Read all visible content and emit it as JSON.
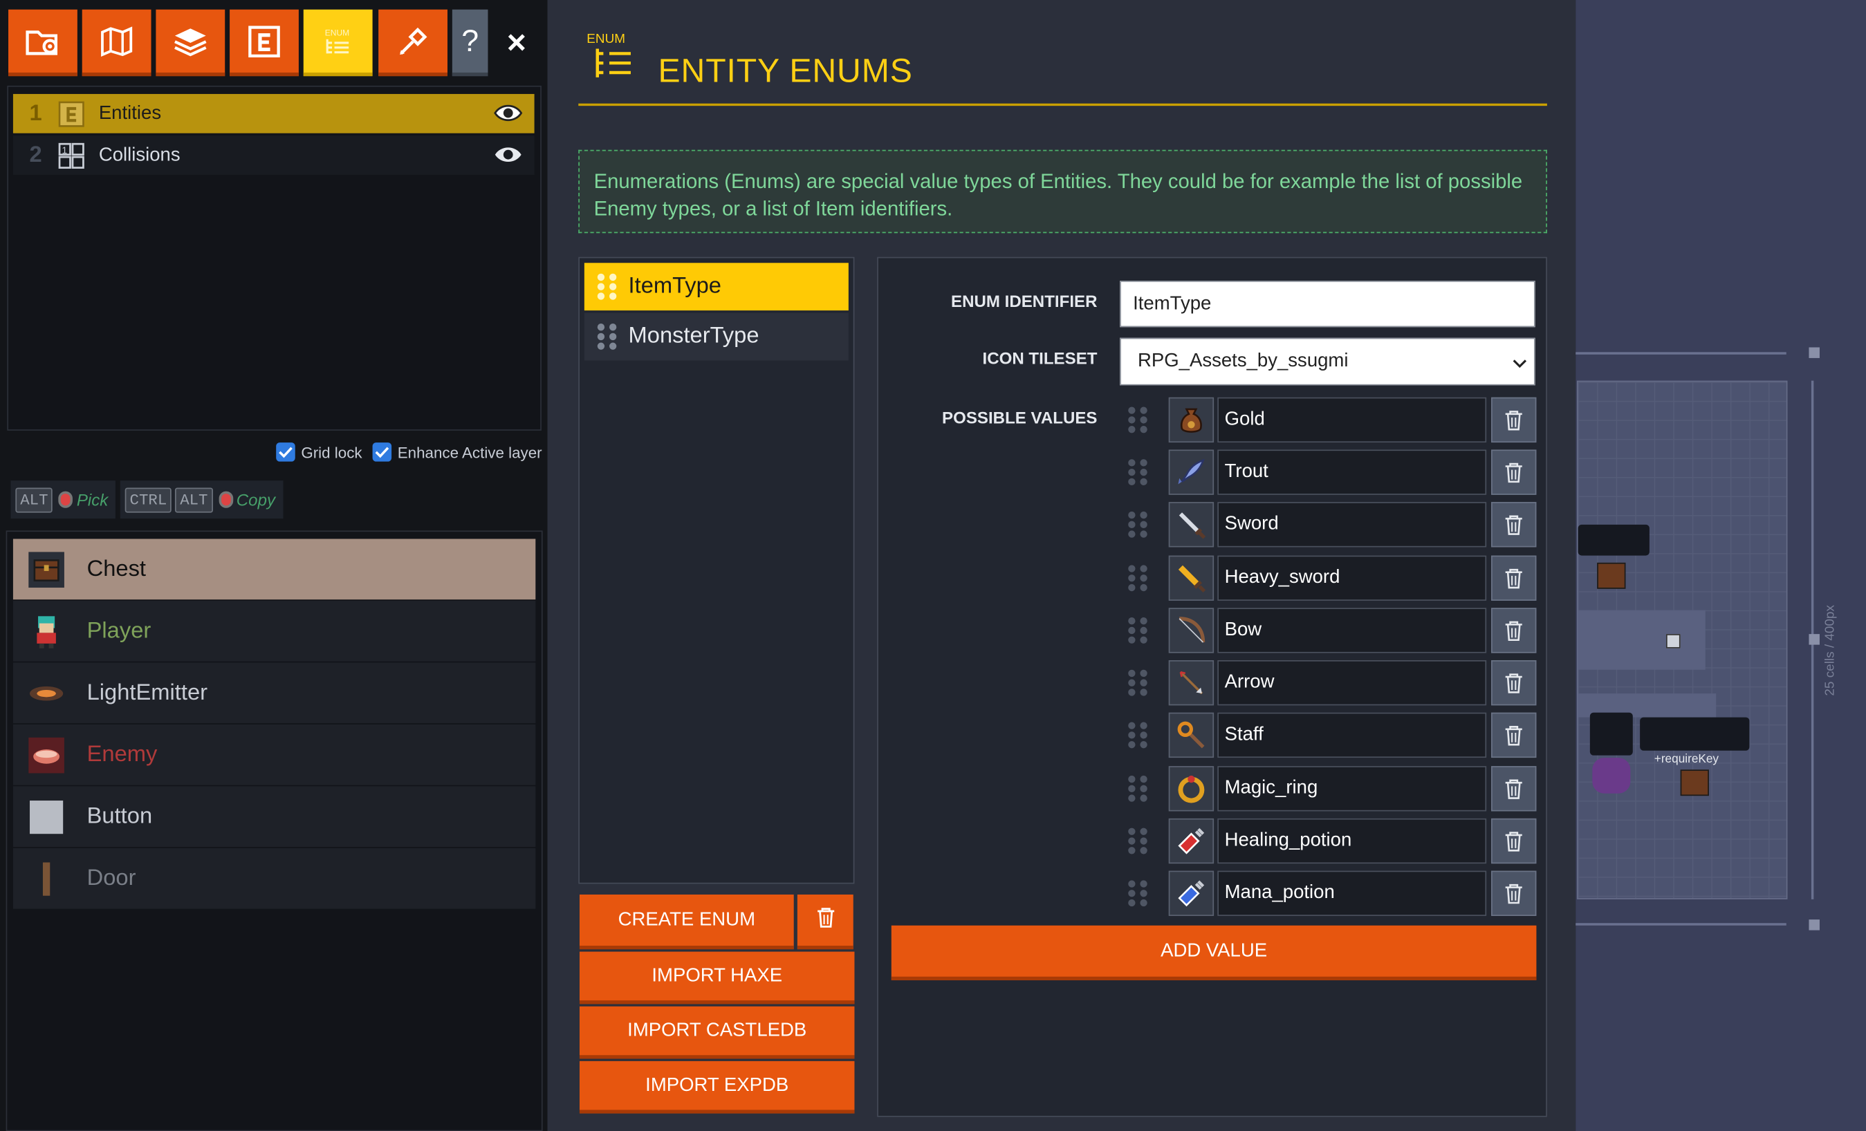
{
  "toolbar": {
    "buttons": [
      {
        "name": "project-settings-icon",
        "active": false
      },
      {
        "name": "world-map-icon",
        "active": false
      },
      {
        "name": "layers-icon",
        "active": false
      },
      {
        "name": "entities-icon",
        "active": false
      },
      {
        "name": "enums-icon",
        "active": true
      },
      {
        "name": "tilesets-icon",
        "active": false
      }
    ],
    "help_label": "?",
    "close_label": "×"
  },
  "layers": [
    {
      "index": "1",
      "name": "Entities",
      "selected": true,
      "icon": "entity-layer-icon"
    },
    {
      "index": "2",
      "name": "Collisions",
      "selected": false,
      "icon": "intgrid-layer-icon"
    }
  ],
  "options": {
    "grid_lock": "Grid lock",
    "enhance_active_layer": "Enhance Active layer"
  },
  "shortcuts": {
    "pick": {
      "keys": [
        "ALT"
      ],
      "action": "Pick"
    },
    "copy": {
      "keys": [
        "CTRL",
        "ALT"
      ],
      "action": "Copy"
    }
  },
  "entities": [
    {
      "name": "Chest",
      "color": "#2a2f38",
      "selected": true
    },
    {
      "name": "Player",
      "color": "#7fa35a"
    },
    {
      "name": "LightEmitter",
      "color": "#c8ccd4"
    },
    {
      "name": "Enemy",
      "color": "#b03a3a"
    },
    {
      "name": "Button",
      "color": "#c8ccd4"
    },
    {
      "name": "Door",
      "color": "#7a7f88"
    }
  ],
  "panel": {
    "badge": "ENUM",
    "title": "ENTITY ENUMS",
    "info": "Enumerations (Enums) are special value types of Entities. They could be for example the list of possible Enemy types, or a list of Item identifiers."
  },
  "enums": [
    {
      "name": "ItemType",
      "selected": true
    },
    {
      "name": "MonsterType",
      "selected": false
    }
  ],
  "enum_buttons": {
    "create": "CREATE ENUM",
    "import_haxe": "IMPORT HAXE",
    "import_castledb": "IMPORT CASTLEDB",
    "import_expdb": "IMPORT EXPDB"
  },
  "form": {
    "identifier_label": "ENUM IDENTIFIER",
    "identifier_value": "ItemType",
    "tileset_label": "ICON TILESET",
    "tileset_value": "RPG_Assets_by_ssugmi",
    "values_label": "POSSIBLE VALUES",
    "add_value": "ADD VALUE",
    "values": [
      {
        "name": "Gold",
        "icon": "gold-bag-icon"
      },
      {
        "name": "Trout",
        "icon": "fish-icon"
      },
      {
        "name": "Sword",
        "icon": "sword-icon"
      },
      {
        "name": "Heavy_sword",
        "icon": "heavy-sword-icon"
      },
      {
        "name": "Bow",
        "icon": "bow-icon"
      },
      {
        "name": "Arrow",
        "icon": "arrow-icon"
      },
      {
        "name": "Staff",
        "icon": "staff-icon"
      },
      {
        "name": "Magic_ring",
        "icon": "ring-icon"
      },
      {
        "name": "Healing_potion",
        "icon": "red-potion-icon"
      },
      {
        "name": "Mana_potion",
        "icon": "blue-potion-icon"
      }
    ]
  },
  "map": {
    "size_label": "25 cells / 400px",
    "tag_label": "+requireKey"
  }
}
